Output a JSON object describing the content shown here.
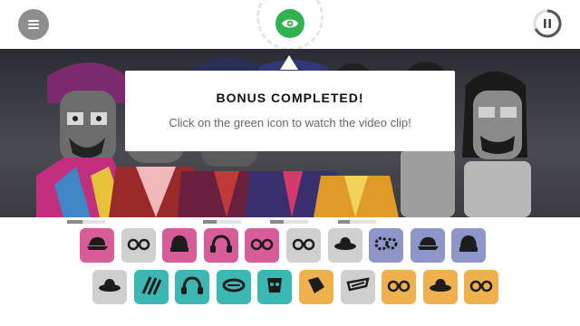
{
  "popup": {
    "title": "BONUS COMPLETED!",
    "message": "Click on the green icon to watch the video clip!"
  },
  "colors": {
    "accent_green": "#2fb34f",
    "pink": "#d75d98",
    "gray": "#cfcfcf",
    "periwinkle": "#8e96c9",
    "teal": "#3bb8b3",
    "orange": "#efb04e"
  },
  "progress_markers": [
    0.4,
    0.35,
    0.35,
    0.3
  ],
  "palette": {
    "row1": [
      {
        "name": "pink-cap-icon",
        "color": "pink"
      },
      {
        "name": "gray-sunglasses-icon",
        "color": "gray"
      },
      {
        "name": "pink-beanie-icon",
        "color": "pink"
      },
      {
        "name": "pink-headphones-icon",
        "color": "pink"
      },
      {
        "name": "pink-glasses-icon",
        "color": "pink"
      },
      {
        "name": "gray-goggles-icon",
        "color": "gray"
      },
      {
        "name": "gray-bucket-hat-icon",
        "color": "gray"
      },
      {
        "name": "blue-gears-icon",
        "color": "periwinkle"
      },
      {
        "name": "blue-visor-icon",
        "color": "periwinkle"
      },
      {
        "name": "blue-bandana-icon",
        "color": "periwinkle"
      }
    ],
    "row2": [
      {
        "name": "gray-fedora-icon",
        "color": "gray"
      },
      {
        "name": "teal-stripes-icon",
        "color": "teal"
      },
      {
        "name": "teal-headphones-icon",
        "color": "teal"
      },
      {
        "name": "teal-halo-icon",
        "color": "teal"
      },
      {
        "name": "teal-mask-icon",
        "color": "teal"
      },
      {
        "name": "orange-paint-icon",
        "color": "orange"
      },
      {
        "name": "gray-scarf-icon",
        "color": "gray"
      },
      {
        "name": "orange-glasses-icon",
        "color": "orange"
      },
      {
        "name": "orange-hat-icon",
        "color": "orange"
      },
      {
        "name": "orange-goggles-icon",
        "color": "orange"
      }
    ]
  }
}
